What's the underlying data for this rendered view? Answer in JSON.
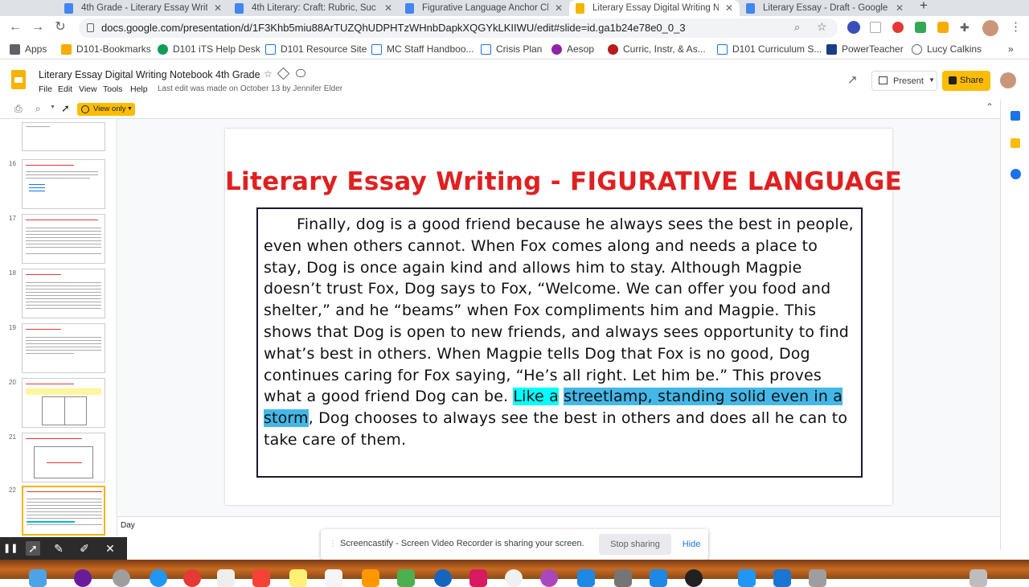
{
  "browser": {
    "tabs": [
      {
        "title": "4th Grade - Literary Essay Writ",
        "color": "#4285f4",
        "active": false
      },
      {
        "title": "4th Literary: Craft: Rubric, Suc",
        "color": "#4285f4",
        "active": false
      },
      {
        "title": "Figurative Language Anchor Ch",
        "color": "#4285f4",
        "active": false
      },
      {
        "title": "Literary Essay Digital Writing N",
        "color": "#f4b400",
        "active": true
      },
      {
        "title": "Literary Essay - Draft - Google",
        "color": "#4285f4",
        "active": false
      }
    ],
    "new_tab": "+",
    "url": "docs.google.com/presentation/d/1F3Khb5miu88ArTUZQhUDPHTzWHnbDapkXQGYkLKIIWU/edit#slide=id.ga1b24e78e0_0_3",
    "bookmarks": [
      {
        "label": "Apps",
        "color": "#5f6368"
      },
      {
        "label": "D101-Bookmarks",
        "color": "#f9ab00"
      },
      {
        "label": "D101 iTS Help Desk",
        "color": "#0f9d58"
      },
      {
        "label": "D101 Resource Site",
        "color": "#1a73e8"
      },
      {
        "label": "MC Staff Handboo...",
        "color": "#1a73e8"
      },
      {
        "label": "Crisis Plan",
        "color": "#1a73e8"
      },
      {
        "label": "Aesop",
        "color": "#8e24aa"
      },
      {
        "label": "Curric, Instr, & As...",
        "color": "#b71c1c"
      },
      {
        "label": "D101 Curriculum S...",
        "color": "#1a73e8"
      },
      {
        "label": "PowerTeacher",
        "color": "#1e3a8a"
      },
      {
        "label": "Lucy Calkins",
        "color": "#5f6368"
      }
    ],
    "more": "»"
  },
  "doc": {
    "title": "Literary Essay Digital Writing Notebook 4th Grade",
    "menu": [
      "File",
      "Edit",
      "View",
      "Tools",
      "Help"
    ],
    "last_edit": "Last edit was made on October 13 by Jennifer Elder",
    "present_label": "Present",
    "share_label": "Share",
    "view_only_label": "View only"
  },
  "filmstrip": {
    "numbers": [
      "16",
      "17",
      "18",
      "19",
      "20",
      "21",
      "22"
    ],
    "selected": "22"
  },
  "slide": {
    "title": "Literary Essay Writing - FIGURATIVE LANGUAGE",
    "para_before": "Finally, dog is a good friend because he always sees the best in people, even when others cannot. When Fox comes along and needs a place to stay, Dog is once again kind and allows him to stay.  Although Magpie doesn’t trust Fox, Dog says to Fox, “Welcome.  We can offer you food and shelter,” and he “beams” when Fox compliments him and Magpie.  This shows that Dog is open to new friends, and always sees opportunity to find what’s best in others. When Magpie tells Dog that Fox is no good, Dog continues caring for Fox saying, “He’s all right.  Let him be.”  This proves what a good friend Dog can be.  ",
    "highlight_cyan": "Like a",
    "highlight_selected": "streetlamp, standing solid even in a storm",
    "para_after": ", Dog chooses to always see the best in others and does all he can to take care of them."
  },
  "notes": "Day",
  "screencastify": {
    "message": "Screencastify - Screen Video Recorder is sharing your screen.",
    "stop_label": "Stop sharing",
    "hide_label": "Hide"
  }
}
